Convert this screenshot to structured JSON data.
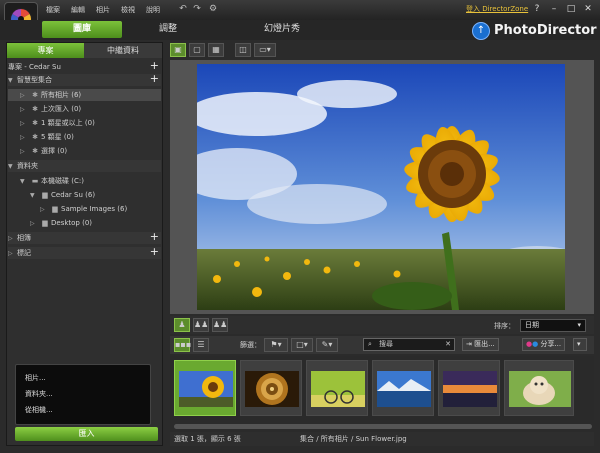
{
  "menu": [
    "檔案",
    "編輯",
    "相片",
    "檢視",
    "說明"
  ],
  "directorzone": "登入 DirectorZone",
  "window_buttons": [
    "?",
    "–",
    "□",
    "✕"
  ],
  "modes": [
    "圖庫",
    "調整",
    "幻燈片秀"
  ],
  "brand": "PhotoDirector",
  "left_tabs": [
    "專案",
    "中繼資料"
  ],
  "project_label": "專案 - Cedar Su",
  "smart_collections": "智慧型集合",
  "collections": [
    {
      "label": "所有相片 (6)"
    },
    {
      "label": "上次匯入 (0)"
    },
    {
      "label": "1 顆星或以上 (0)"
    },
    {
      "label": "5 顆星 (0)"
    },
    {
      "label": "選擇 (0)"
    }
  ],
  "folders_label": "資料夾",
  "folders": [
    {
      "label": "本機磁碟 (C:)"
    },
    {
      "label": "Cedar Su (6)"
    },
    {
      "label": "Sample Images (6)"
    },
    {
      "label": "Desktop (0)"
    }
  ],
  "albums_label": "相簿",
  "tags_label": "標記",
  "import_menu": [
    "相片...",
    "資料夾...",
    "從相機..."
  ],
  "import_button": "匯入",
  "sort_label": "排序：",
  "sort_value": "日期",
  "filter_label": "篩選：",
  "search_placeholder": "搜尋",
  "export_button": "匯出...",
  "share_button": "分享...",
  "status": {
    "left": "選取 1 張，顯示 6 張",
    "path": "集合 / 所有相片 / Sun Flower.jpg"
  },
  "colors": {
    "accent": "#6aa930",
    "brand_blue": "#1a6fd1",
    "link": "#e8c23a"
  }
}
